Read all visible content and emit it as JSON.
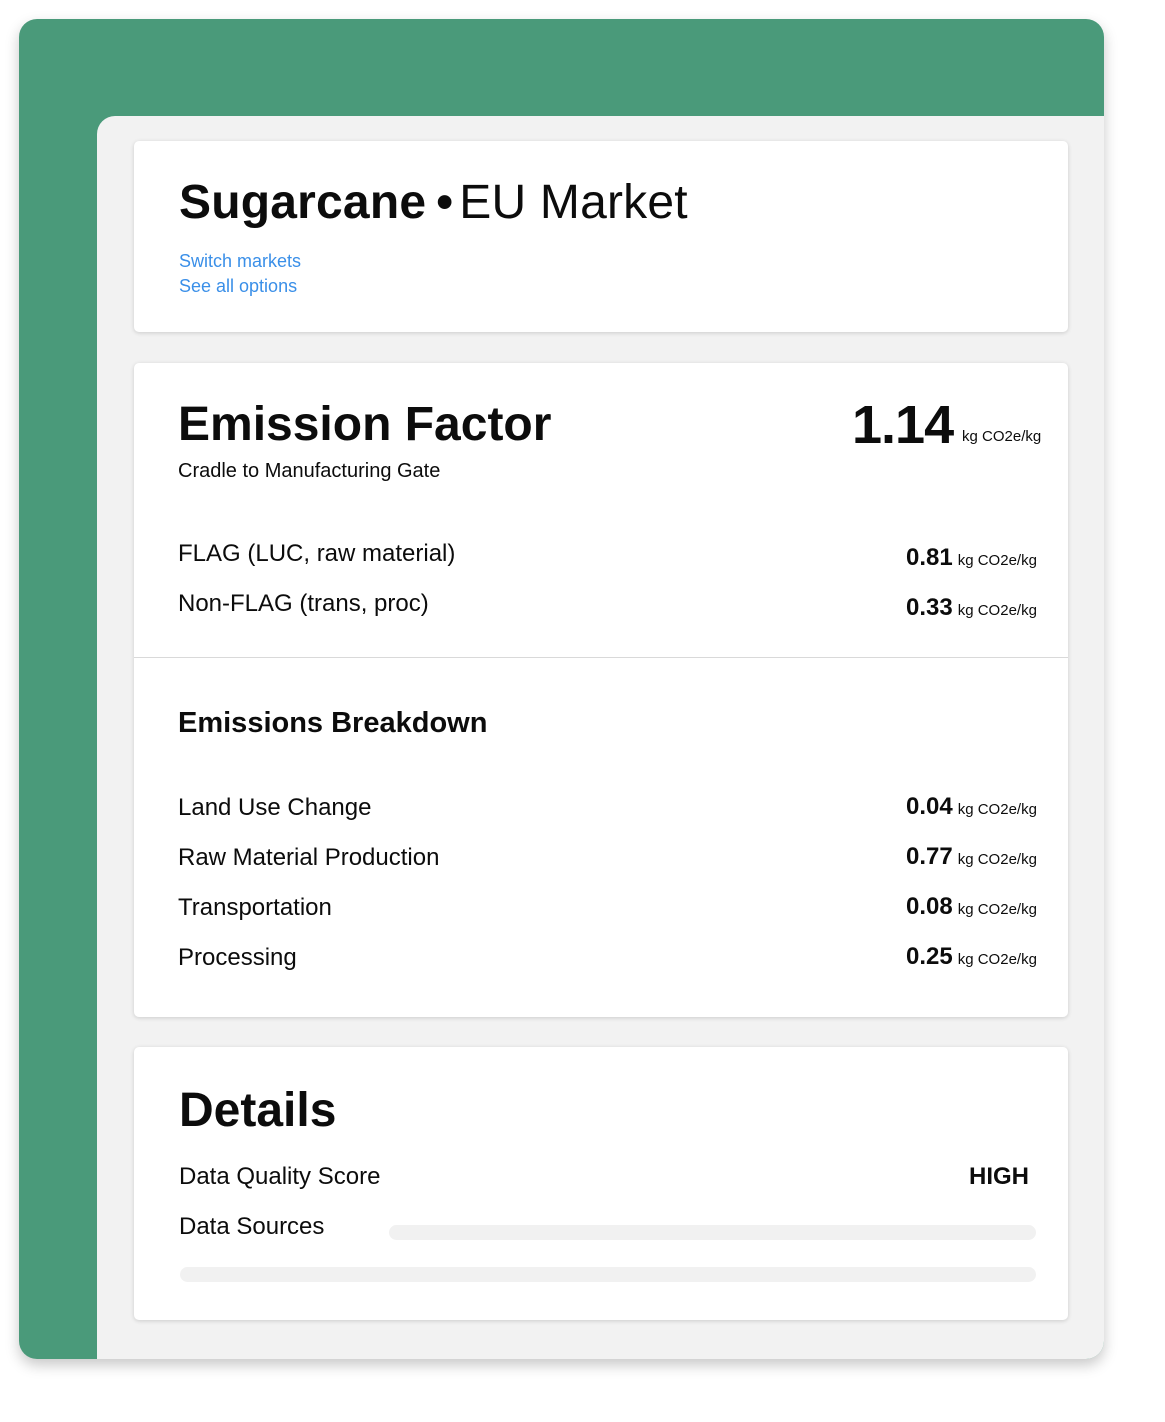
{
  "header": {
    "product": "Sugarcane",
    "separator": "•",
    "market": "EU Market",
    "links": {
      "switch_markets": "Switch markets",
      "see_all_options": "See all options"
    }
  },
  "emission_factor": {
    "title": "Emission Factor",
    "subtitle": "Cradle to Manufacturing Gate",
    "value": "1.14",
    "unit": "kg CO2e/kg",
    "rows": [
      {
        "label": "FLAG (LUC, raw material)",
        "value": "0.81",
        "unit": "kg CO2e/kg"
      },
      {
        "label": "Non-FLAG (trans, proc)",
        "value": "0.33",
        "unit": "kg CO2e/kg"
      }
    ]
  },
  "breakdown": {
    "title": "Emissions Breakdown",
    "rows": [
      {
        "label": "Land Use Change",
        "value": "0.04",
        "unit": "kg CO2e/kg"
      },
      {
        "label": "Raw Material Production",
        "value": "0.77",
        "unit": "kg CO2e/kg"
      },
      {
        "label": "Transportation",
        "value": "0.08",
        "unit": "kg CO2e/kg"
      },
      {
        "label": "Processing",
        "value": "0.25",
        "unit": "kg CO2e/kg"
      }
    ]
  },
  "details": {
    "title": "Details",
    "data_quality_label": "Data Quality Score",
    "data_quality_value": "HIGH",
    "data_sources_label": "Data Sources"
  },
  "colors": {
    "frame_green": "#4a9a7a",
    "link_blue": "#3a8fe8",
    "panel_grey": "#f2f2f2"
  }
}
